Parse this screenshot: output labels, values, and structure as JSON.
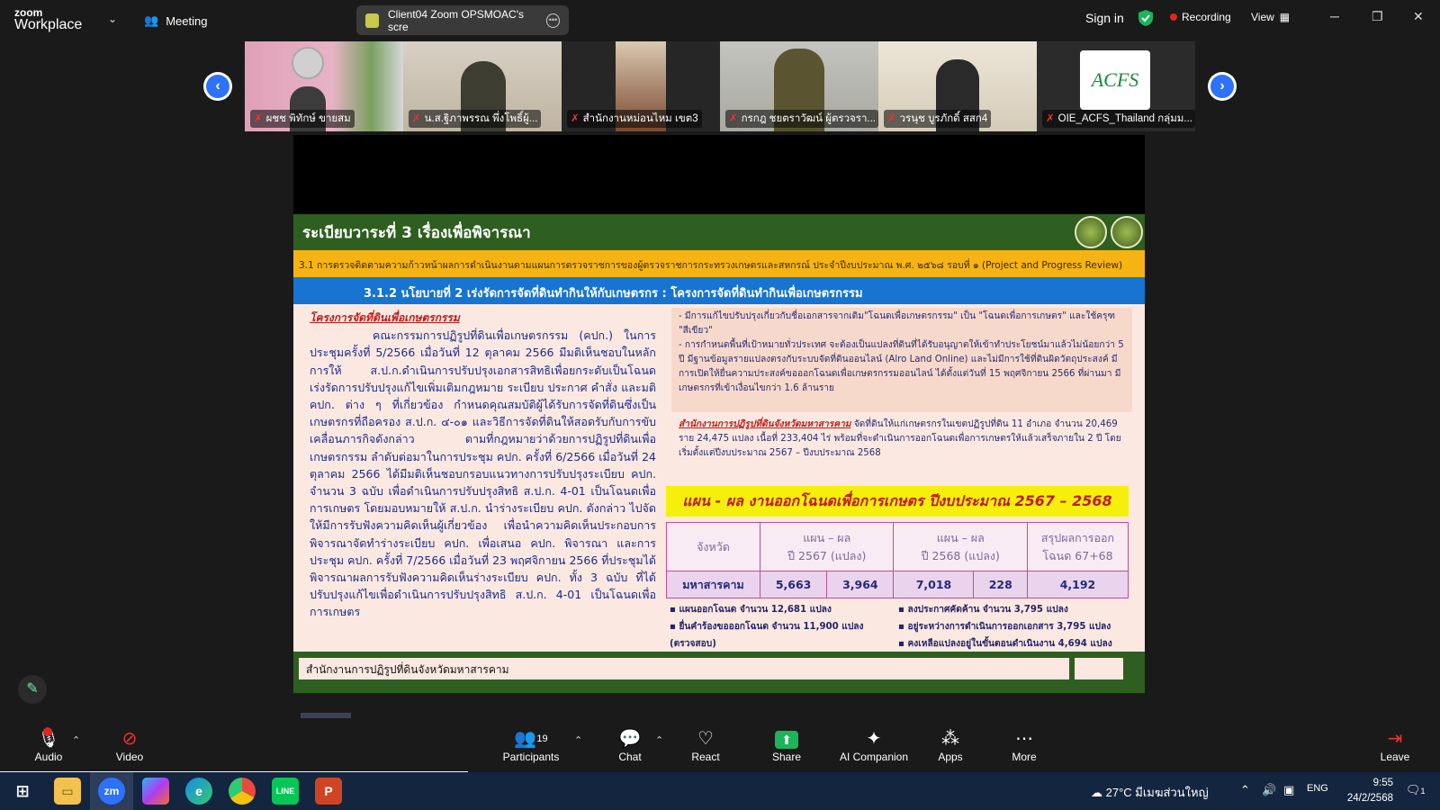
{
  "app": {
    "logo_small": "zoom",
    "logo_big": "Workplace",
    "meeting_label": "Meeting",
    "share_title": "Client04 Zoom OPSMOAC's scre",
    "signin": "Sign in",
    "recording": "Recording",
    "view": "View"
  },
  "participants": [
    {
      "name": "ผชช พิทักษ์ ขายสม"
    },
    {
      "name": "น.ส.ฐิภาพรรณ พึ่งโพธิ์ผู้..."
    },
    {
      "name": "สำนักงานหม่อนไหม เขต3"
    },
    {
      "name": "กรกฎ ชยตราวัฒน์ ผู้ตรวจรา..."
    },
    {
      "name": "วรนุช บูรภักดิ์ สสก4"
    },
    {
      "name": "OIE_ACFS_Thailand กลุ่มม..."
    }
  ],
  "acfs_logo_text": "ACFS",
  "slide": {
    "header": "ระเบียบวาระที่ 3 เรื่องเพื่อพิจารณา",
    "subheader": "3.1 การตรวจติดตามความก้าวหน้าผลการดำเนินงานตามแผนการตรวจราชการของผู้ตรวจราชการกระทรวงเกษตรและสหกรณ์ ประจำปีงบประมาณ พ.ศ. ๒๕๖๘ รอบที่ ๑ (Project and Progress Review)",
    "blue_title": "3.1.2 นโยบายที่ 2 เร่งรัดการจัดที่ดินทำกินให้กับเกษตรกร : โครงการจัดที่ดินทำกินเพื่อเกษตรกรรม",
    "left_title": "โครงการจัดที่ดินเพื่อเกษตรกรรม",
    "left_body": "คณะกรรมการปฏิรูปที่ดินเพื่อเกษตรกรรม (คปก.) ในการประชุมครั้งที่ 5/2566 เมื่อวันที่ 12 ตุลาคม 2566 มีมติเห็นชอบในหลักการให้ ส.ป.ก.ดำเนินการปรับปรุงเอกสารสิทธิเพื่อยกระดับเป็นโฉนด เร่งรัดการปรับปรุงแก้ไขเพิ่มเติมกฎหมาย ระเบียบ ประกาศ คำสั่ง และมติ คปก. ต่าง ๆ ที่เกี่ยวข้อง กำหนดคุณสมบัติผู้ได้รับการจัดที่ดินซึ่งเป็นเกษตรกรที่ถือครอง ส.ป.ก. ๔-๐๑ และวิธีการจัดที่ดินให้สอดรับกับการขับเคลื่อนภารกิจดังกล่าว ตามที่กฎหมายว่าด้วยการปฏิรูปที่ดินเพื่อเกษตรกรรม ลำดับต่อมาในการประชุม คปก. ครั้งที่ 6/2566 เมื่อวันที่ 24 ตุลาคม 2566 ได้มีมติเห็นชอบกรอบแนวทางการปรับปรุงระเบียบ คปก. จำนวน 3 ฉบับ เพื่อดำเนินการปรับปรุงสิทธิ ส.ป.ก. 4-01 เป็นโฉนดเพื่อการเกษตร โดยมอบหมายให้ ส.ป.ก. นำร่างระเบียบ คปก. ดังกล่าว ไปจัดให้มีการรับฟังความคิดเห็นผู้เกี่ยวข้อง เพื่อนำความคิดเห็นประกอบการพิจารณาจัดทำร่างระเบียบ คปก. เพื่อเสนอ คปก. พิจารณา และการประชุม คปก. ครั้งที่ 7/2566 เมื่อวันที่ 23 พฤศจิกายน 2566 ที่ประชุมได้พิจารณาผลการรับฟังความคิดเห็นร่างระเบียบ คปก. ทั้ง 3 ฉบับ ที่ได้ปรับปรุงแก้ไขเพื่อดำเนินการปรับปรุงสิทธิ ส.ป.ก. 4-01 เป็นโฉนดเพื่อการเกษตร",
    "right_p1": "- มีการแก้ไขปรับปรุงเกี่ยวกับชื่อเอกสารจากเดิม\"โฉนดเพื่อเกษตรกรรม\" เป็น \"โฉนดเพื่อการเกษตร\" และใช้ครุฑ \"สีเขียว\"",
    "right_p2": "- การกำหนดพื้นที่เป้าหมายทั่วประเทศ จะต้องเป็นแปลงที่ดินที่ได้รับอนุญาตให้เข้าทำประโยชน์มาแล้วไม่น้อยกว่า 5 ปี มีฐานข้อมูลรายแปลงตรงกับระบบจัดที่ดินออนไลน์ (Alro Land Online) และไม่มีการใช้ที่ดินผิดวัตถุประสงค์ มีการเปิดให้ยื่นความประสงค์ขอออกโฉนดเพื่อเกษตรกรรมออนไลน์ ได้ตั้งแต่วันที่ 15 พฤศจิกายน 2566 ที่ผ่านมา มีเกษตรกรที่เข้าเงื่อนไขกว่า 1.6 ล้านราย",
    "right_title2": "สำนักงานการปฏิรูปที่ดินจังหวัดมหาสารคาม",
    "right_p3": " จัดที่ดินให้แก่เกษตรกรในเขตปฏิรูปที่ดิน 11 อำเภอ จำนวน 20,469 ราย 24,475 แปลง เนื้อที่ 233,404 ไร่ พร้อมที่จะดำเนินการออกโฉนดเพื่อการเกษตรให้แล้วเสร็จภายใน 2 ปี โดยเริ่มตั้งแต่ปีงบประมาณ 2567 – ปีงบประมาณ 2568",
    "plan_banner": "แผน - ผล งานออกโฉนดเพื่อการเกษตร ปีงบประมาณ 2567 – 2568",
    "table": {
      "h_province": "จังหวัด",
      "h_2567": "แผน – ผล\nปี 2567 (แปลง)",
      "h_2568": "แผน – ผล\nปี 2568 (แปลง)",
      "h_sum": "สรุปผลการออก\nโฉนด 67+68",
      "row": [
        "มหาสารคาม",
        "5,663",
        "3,964",
        "7,018",
        "228",
        "4,192"
      ]
    },
    "bullets_left": [
      "แผนออกโฉนด จำนวน 12,681 แปลง",
      "ยื่นคำร้องขอออกโฉนด จำนวน 11,900 แปลง (ตรวจสอบ)"
    ],
    "bullets_right": [
      "ลงประกาศคัดค้าน จำนวน 3,795 แปลง",
      "อยู่ระหว่างการดำเนินการออกเอกสาร 3,795 แปลง",
      "คงเหลือแปลงอยู่ในขั้นตอนดำเนินงาน 4,694 แปลง"
    ],
    "footer": "สำนักงานการปฏิรูปที่ดินจังหวัดมหาสารคาม"
  },
  "toolbar": {
    "audio": "Audio",
    "video": "Video",
    "participants": "Participants",
    "participants_count": "19",
    "chat": "Chat",
    "react": "React",
    "share": "Share",
    "ai": "AI Companion",
    "apps": "Apps",
    "more": "More",
    "leave": "Leave"
  },
  "taskbar": {
    "weather": "27°C",
    "weather_desc": "มีเมฆส่วนใหญ่",
    "lang": "ENG",
    "time": "9:55",
    "date": "24/2/2568",
    "notif_count": "1"
  }
}
